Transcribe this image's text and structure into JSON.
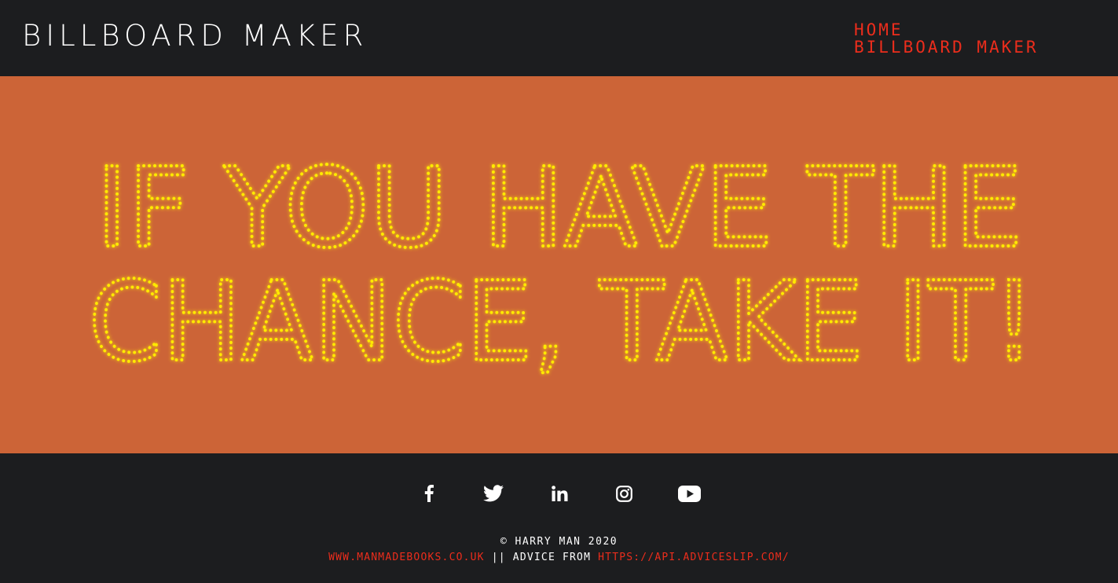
{
  "header": {
    "title": "BILLBOARD MAKER",
    "nav": [
      {
        "label": "HOME"
      },
      {
        "label": "BILLBOARD MAKER"
      }
    ]
  },
  "billboard": {
    "lines": [
      "IF YOU HAVE THE",
      "CHANCE, TAKE IT!"
    ],
    "background_color": "#cc6437",
    "light_color": "#ffea00"
  },
  "footer": {
    "social": [
      {
        "name": "facebook",
        "icon": "facebook-icon"
      },
      {
        "name": "twitter",
        "icon": "twitter-icon"
      },
      {
        "name": "linkedin",
        "icon": "linkedin-icon"
      },
      {
        "name": "instagram",
        "icon": "instagram-icon"
      },
      {
        "name": "youtube",
        "icon": "youtube-icon"
      }
    ],
    "copyright": "© HARRY MAN 2020",
    "site_link": "WWW.MANMADEBOOKS.CO.UK",
    "separator": " || ADVICE FROM ",
    "api_link": "HTTPS://API.ADVICESLIP.COM/",
    "accent_color": "#ec2d1c"
  }
}
